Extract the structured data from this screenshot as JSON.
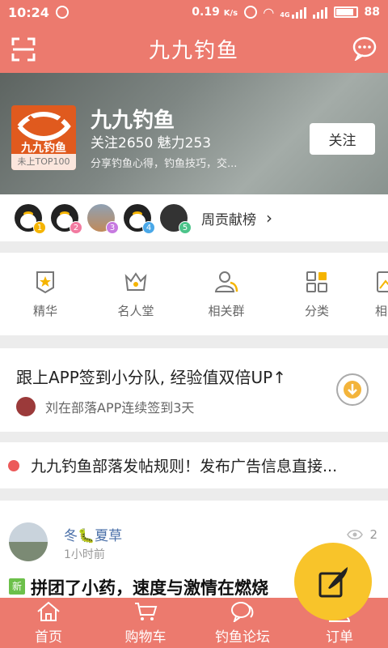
{
  "status_bar": {
    "time": "10:24",
    "speed": "0.19",
    "speed_unit": "K/s",
    "network": "4G",
    "battery": "88"
  },
  "header": {
    "title": "九九钓鱼"
  },
  "profile": {
    "logo_text": "九九钓鱼",
    "rank_label": "未上TOP100",
    "name": "九九钓鱼",
    "stats": "关注2650 魅力253",
    "description": "分享钓鱼心得，钓鱼技巧，交...",
    "follow_label": "关注"
  },
  "contributors": {
    "badges": [
      "1",
      "2",
      "3",
      "4",
      "5"
    ],
    "label": "周贡献榜",
    "arrow": "›"
  },
  "categories": [
    {
      "label": "精华",
      "icon": "star-badge-icon"
    },
    {
      "label": "名人堂",
      "icon": "crown-icon"
    },
    {
      "label": "相关群",
      "icon": "group-icon"
    },
    {
      "label": "分类",
      "icon": "grid-icon"
    },
    {
      "label": "相",
      "icon": "image-icon"
    }
  ],
  "signin": {
    "title": "跟上APP签到小分队, 经验值双倍UP↑",
    "subtitle": "刘在部落APP连续签到3天"
  },
  "notice": {
    "text": "九九钓鱼部落发帖规则！发布广告信息直接..."
  },
  "post": {
    "author": "冬🐛夏草",
    "time": "1小时前",
    "views": "2",
    "tag": "新",
    "title": "拼团了小药，速度与激情在燃烧"
  },
  "tabbar": {
    "items": [
      {
        "label": "首页",
        "icon": "home-icon"
      },
      {
        "label": "购物车",
        "icon": "cart-icon"
      },
      {
        "label": "钓鱼论坛",
        "icon": "forum-icon"
      },
      {
        "label": "订单",
        "icon": "user-icon"
      }
    ]
  },
  "colors": {
    "brand": "#ec7a6e",
    "accent_yellow": "#f8c42a",
    "link_blue": "#4a6fa8"
  }
}
